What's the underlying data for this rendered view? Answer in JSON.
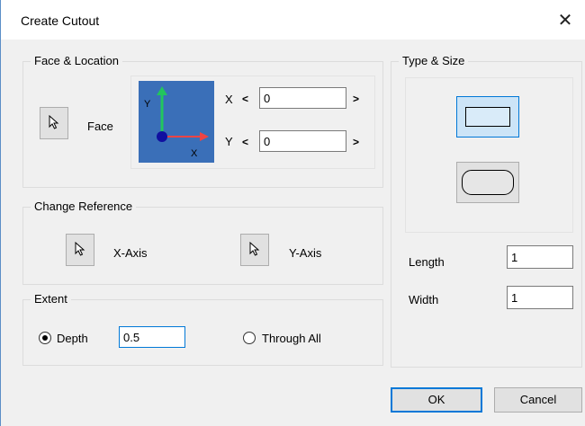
{
  "window": {
    "title": "Create Cutout",
    "close_glyph": "✕"
  },
  "face_location": {
    "label": "Face & Location",
    "face_label": "Face",
    "x_label": "X",
    "y_label": "Y",
    "x_value": "0",
    "y_value": "0",
    "prev_arrow": "<",
    "next_arrow": ">",
    "axis_y": "Y",
    "axis_x": "X"
  },
  "change_reference": {
    "label": "Change Reference",
    "x_axis_label": "X-Axis",
    "y_axis_label": "Y-Axis"
  },
  "extent": {
    "label": "Extent",
    "depth_label": "Depth",
    "depth_value": "0.5",
    "through_all_label": "Through All",
    "selected": "depth"
  },
  "type_size": {
    "label": "Type & Size",
    "selected_shape": "rectangle",
    "length_label": "Length",
    "length_value": "1",
    "width_label": "Width",
    "width_value": "1"
  },
  "buttons": {
    "ok": "OK",
    "cancel": "Cancel"
  },
  "colors": {
    "preview_bg": "#3a6fb8",
    "accent": "#0078d7",
    "axis_y": "#22c55e",
    "axis_x": "#ef4444",
    "origin": "#1010a0"
  }
}
